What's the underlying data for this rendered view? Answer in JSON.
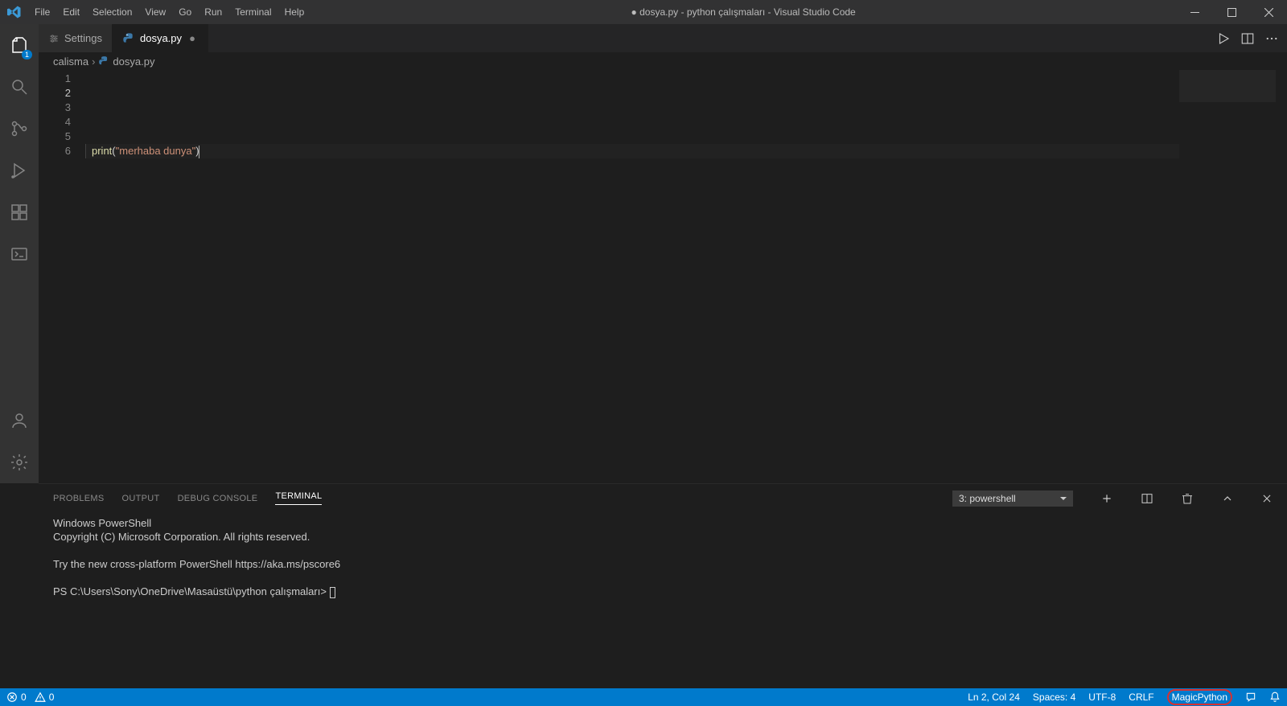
{
  "title": "● dosya.py - python çalışmaları - Visual Studio Code",
  "menubar": [
    "File",
    "Edit",
    "Selection",
    "View",
    "Go",
    "Run",
    "Terminal",
    "Help"
  ],
  "tabs": [
    {
      "label": "Settings",
      "icon": "gear",
      "active": false,
      "dirty": false
    },
    {
      "label": "dosya.py",
      "icon": "python",
      "active": true,
      "dirty": true
    }
  ],
  "breadcrumb": {
    "folder": "calisma",
    "file": "dosya.py"
  },
  "code_lines": [
    {
      "n": 1,
      "content": ""
    },
    {
      "n": 2,
      "fn": "print",
      "open": "(",
      "str": "\"merhaba dunya\"",
      "close": ")"
    },
    {
      "n": 3,
      "content": ""
    },
    {
      "n": 4,
      "content": ""
    },
    {
      "n": 5,
      "content": ""
    },
    {
      "n": 6,
      "content": ""
    }
  ],
  "activity_badge": "1",
  "panel": {
    "tabs": [
      "PROBLEMS",
      "OUTPUT",
      "DEBUG CONSOLE",
      "TERMINAL"
    ],
    "active": "TERMINAL",
    "terminal_select": "3: powershell",
    "lines": [
      "Windows PowerShell",
      "Copyright (C) Microsoft Corporation. All rights reserved.",
      "",
      "Try the new cross-platform PowerShell https://aka.ms/pscore6",
      "",
      "PS C:\\Users\\Sony\\OneDrive\\Masaüstü\\python çalışmaları> "
    ]
  },
  "status": {
    "errors": "0",
    "warnings": "0",
    "cursor": "Ln 2, Col 24",
    "spaces": "Spaces: 4",
    "encoding": "UTF-8",
    "eol": "CRLF",
    "lang": "MagicPython"
  }
}
